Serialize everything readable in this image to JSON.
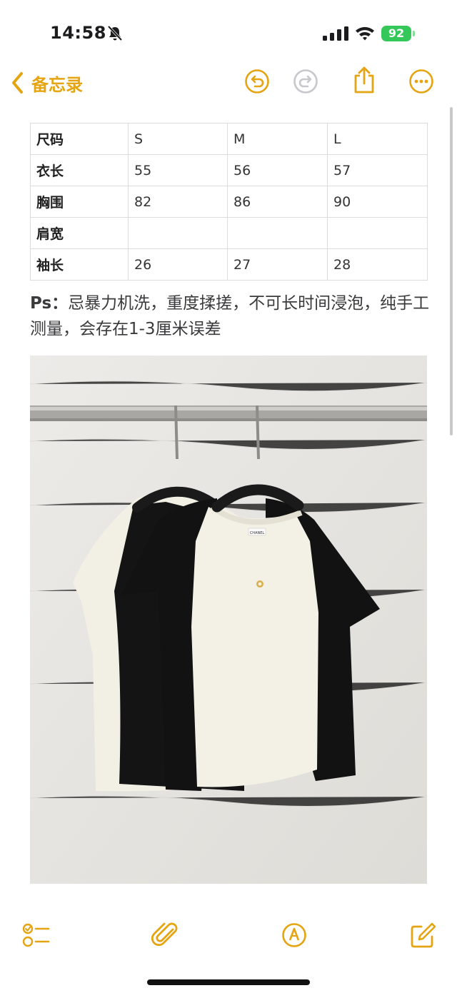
{
  "status": {
    "time": "14:58",
    "battery": "92"
  },
  "nav": {
    "back_label": "备忘录"
  },
  "size_table": {
    "header": [
      "尺码",
      "S",
      "M",
      "L"
    ],
    "rows": [
      [
        "衣长",
        "55",
        "56",
        "57"
      ],
      [
        "胸围",
        "82",
        "86",
        "90"
      ],
      [
        "肩宽",
        "",
        "",
        ""
      ],
      [
        "袖长",
        "26",
        "27",
        "28"
      ]
    ]
  },
  "note": {
    "prefix": "Ps：",
    "text": "忌暴力机洗，重度揉搓，不可长时间浸泡，纯手工测量，会存在1-3厘米误差"
  },
  "photo": {
    "label_text": "CHANEL"
  },
  "colors": {
    "accent": "#e5a411",
    "battery": "#34c759"
  },
  "icons": {
    "back": "chevron-left-icon",
    "undo": "undo-icon",
    "redo": "redo-icon",
    "share": "share-icon",
    "more": "more-icon",
    "checklist": "checklist-icon",
    "attach": "paperclip-icon",
    "markup": "pen-tip-icon",
    "compose": "compose-icon"
  }
}
